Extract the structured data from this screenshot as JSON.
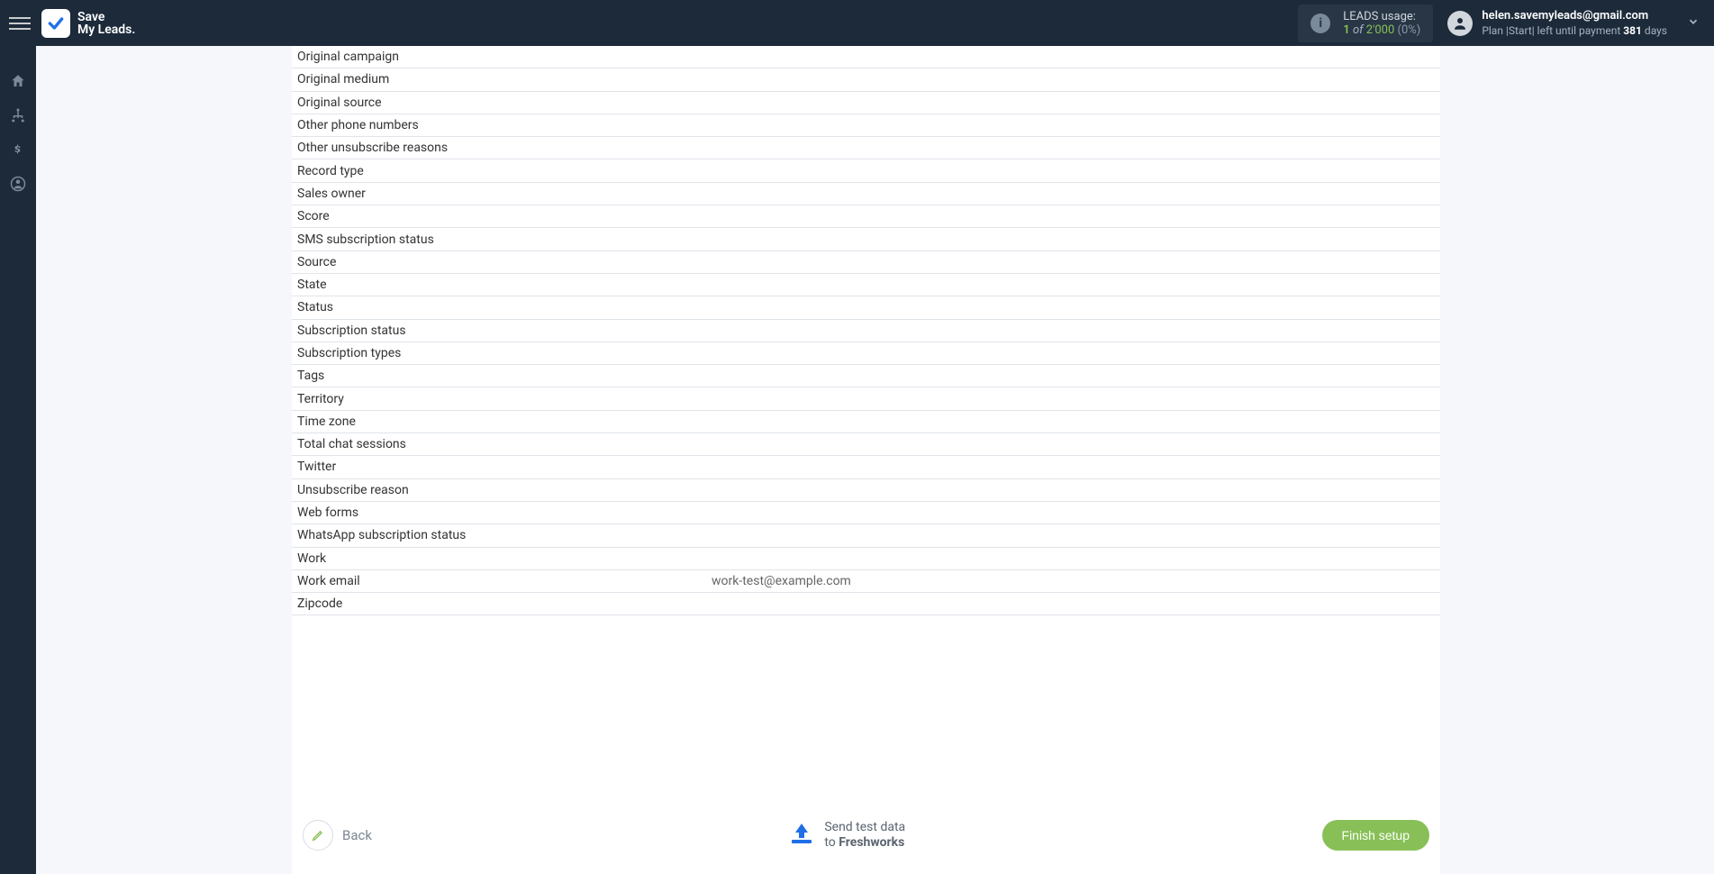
{
  "header": {
    "logo_line1": "Save",
    "logo_line2": "My Leads.",
    "leads_usage_label": "LEADS usage:",
    "leads_used": "1",
    "leads_of": "of",
    "leads_total": "2'000",
    "leads_pct": "(0%)",
    "user_email": "helen.savemyleads@gmail.com",
    "plan_prefix": "Plan |",
    "plan_name": "Start",
    "plan_middle": "| left until payment",
    "plan_days": "381",
    "plan_days_suffix": "days"
  },
  "fields": [
    {
      "label": "Original campaign",
      "value": ""
    },
    {
      "label": "Original medium",
      "value": ""
    },
    {
      "label": "Original source",
      "value": ""
    },
    {
      "label": "Other phone numbers",
      "value": ""
    },
    {
      "label": "Other unsubscribe reasons",
      "value": ""
    },
    {
      "label": "Record type",
      "value": ""
    },
    {
      "label": "Sales owner",
      "value": ""
    },
    {
      "label": "Score",
      "value": ""
    },
    {
      "label": "SMS subscription status",
      "value": ""
    },
    {
      "label": "Source",
      "value": ""
    },
    {
      "label": "State",
      "value": ""
    },
    {
      "label": "Status",
      "value": ""
    },
    {
      "label": "Subscription status",
      "value": ""
    },
    {
      "label": "Subscription types",
      "value": ""
    },
    {
      "label": "Tags",
      "value": ""
    },
    {
      "label": "Territory",
      "value": ""
    },
    {
      "label": "Time zone",
      "value": ""
    },
    {
      "label": "Total chat sessions",
      "value": ""
    },
    {
      "label": "Twitter",
      "value": ""
    },
    {
      "label": "Unsubscribe reason",
      "value": ""
    },
    {
      "label": "Web forms",
      "value": ""
    },
    {
      "label": "WhatsApp subscription status",
      "value": ""
    },
    {
      "label": "Work",
      "value": ""
    },
    {
      "label": "Work email",
      "value": "work-test@example.com"
    },
    {
      "label": "Zipcode",
      "value": ""
    }
  ],
  "footer": {
    "back_label": "Back",
    "send_line1": "Send test data",
    "send_to": "to",
    "send_brand": "Freshworks",
    "finish_label": "Finish setup"
  }
}
